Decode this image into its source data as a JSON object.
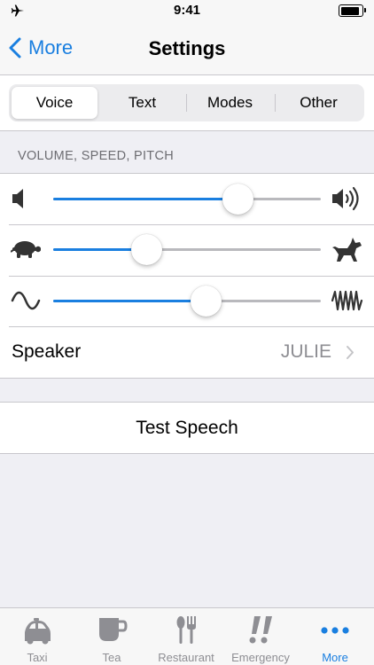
{
  "status_bar": {
    "time": "9:41"
  },
  "nav": {
    "back_label": "More",
    "title": "Settings"
  },
  "segments": [
    {
      "label": "Voice",
      "active": true
    },
    {
      "label": "Text",
      "active": false
    },
    {
      "label": "Modes",
      "active": false
    },
    {
      "label": "Other",
      "active": false
    }
  ],
  "section": {
    "header": "VOLUME, SPEED, PITCH"
  },
  "sliders": {
    "volume": {
      "value": 0.69
    },
    "speed": {
      "value": 0.35
    },
    "pitch": {
      "value": 0.57
    }
  },
  "speaker": {
    "label": "Speaker",
    "value": "JULIE"
  },
  "test_speech": {
    "label": "Test Speech"
  },
  "tabs": [
    {
      "label": "Taxi",
      "icon": "car-icon",
      "active": false
    },
    {
      "label": "Tea",
      "icon": "tea-cup-icon",
      "active": false
    },
    {
      "label": "Restaurant",
      "icon": "fork-knife-icon",
      "active": false
    },
    {
      "label": "Emergency",
      "icon": "double-exclamation-icon",
      "active": false
    },
    {
      "label": "More",
      "icon": "more-dots-icon",
      "active": true
    }
  ],
  "colors": {
    "accent": "#1a7fe0",
    "inactive": "#8e8e93",
    "background": "#efeff4"
  }
}
